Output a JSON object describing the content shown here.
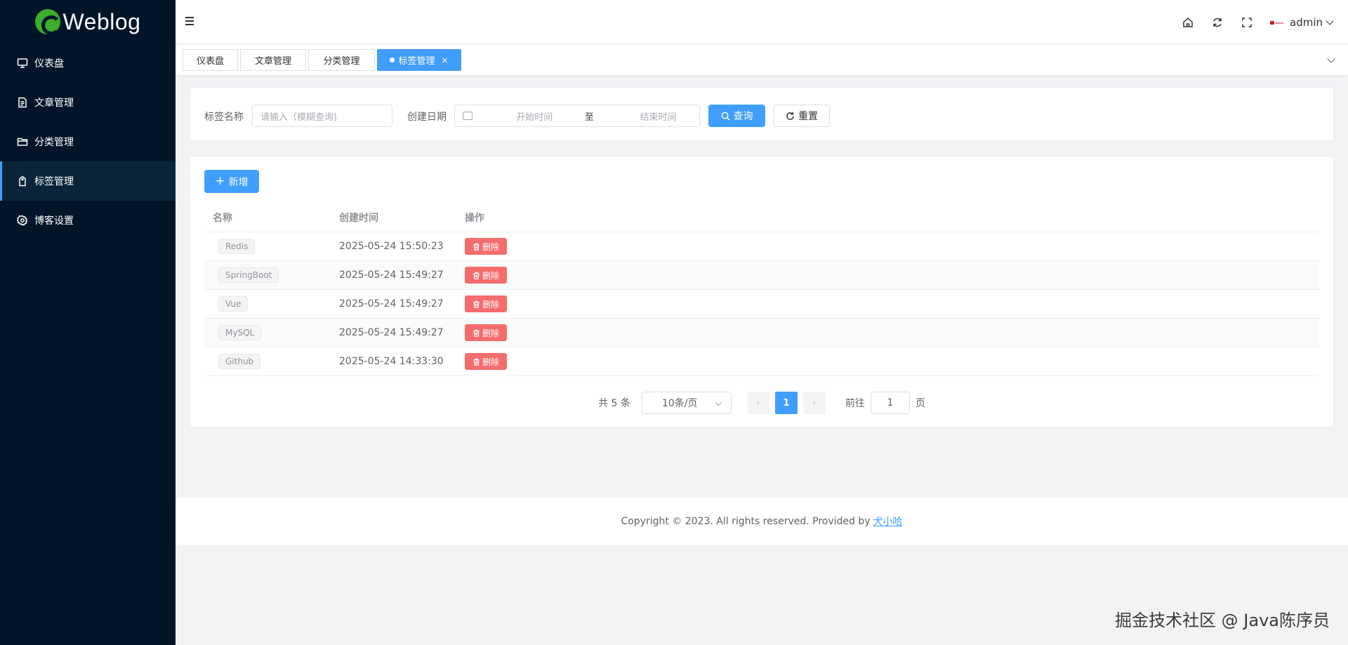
{
  "brand": {
    "name": "Weblog"
  },
  "sidebar": {
    "items": [
      {
        "label": "仪表盘",
        "icon": "monitor-icon",
        "active": false
      },
      {
        "label": "文章管理",
        "icon": "document-icon",
        "active": false
      },
      {
        "label": "分类管理",
        "icon": "folder-icon",
        "active": false
      },
      {
        "label": "标签管理",
        "icon": "tag-icon",
        "active": true
      },
      {
        "label": "博客设置",
        "icon": "gear-icon",
        "active": false
      }
    ]
  },
  "header": {
    "icons": [
      "home-icon",
      "refresh-icon",
      "fullscreen-icon"
    ],
    "user": {
      "name": "admin"
    }
  },
  "tabs": [
    {
      "label": "仪表盘",
      "active": false
    },
    {
      "label": "文章管理",
      "active": false
    },
    {
      "label": "分类管理",
      "active": false
    },
    {
      "label": "标签管理",
      "active": true,
      "close": "×"
    }
  ],
  "search": {
    "name_label": "标签名称",
    "name_placeholder": "请输入（模糊查询)",
    "date_label": "创建日期",
    "date_start_placeholder": "开始时间",
    "date_separator": "至",
    "date_end_placeholder": "结束时间",
    "query_button": "查询",
    "reset_button": "重置"
  },
  "toolbar": {
    "add_button": "新增"
  },
  "table": {
    "columns": [
      "名称",
      "创建时间",
      "操作"
    ],
    "rows": [
      {
        "name": "Redis",
        "created": "2025-05-24 15:50:23",
        "action": "删除"
      },
      {
        "name": "SpringBoot",
        "created": "2025-05-24 15:49:27",
        "action": "删除"
      },
      {
        "name": "Vue",
        "created": "2025-05-24 15:49:27",
        "action": "删除"
      },
      {
        "name": "MySQL",
        "created": "2025-05-24 15:49:27",
        "action": "删除"
      },
      {
        "name": "Github",
        "created": "2025-05-24 14:33:30",
        "action": "删除"
      }
    ]
  },
  "pagination": {
    "total_text": "共 5 条",
    "page_size": "10条/页",
    "prev": "‹",
    "current_page": "1",
    "next": "›",
    "goto_label": "前往",
    "goto_value": "1",
    "goto_suffix": "页"
  },
  "footer": {
    "text": "Copyright © 2023. All rights reserved. Provided by",
    "link": "犬小哈"
  },
  "watermark": "掘金技术社区 @ Java陈序员",
  "colors": {
    "primary": "#409eff",
    "danger": "#f56c6c",
    "sidebar_bg": "#00152a",
    "brand_green": "#3dae2b"
  }
}
